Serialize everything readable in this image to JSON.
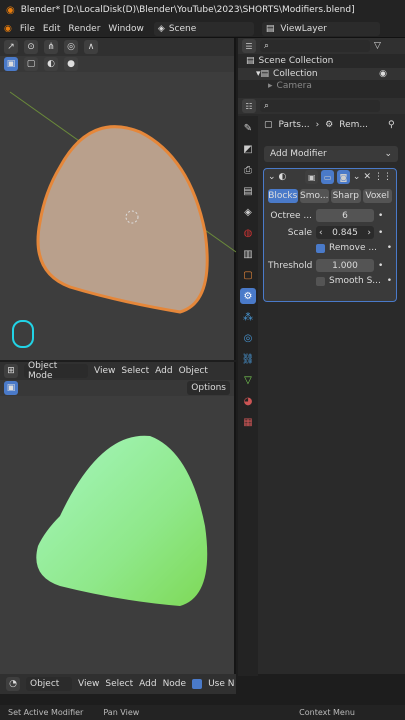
{
  "title": "Blender* [D:\\LocalDisk(D)\\Blender\\YouTube\\2023\\SHORTS\\Modifiers.blend]",
  "menu": [
    "File",
    "Edit",
    "Render",
    "Window"
  ],
  "scene": "Scene",
  "view_layer": "ViewLayer",
  "outliner": {
    "scene_collection": "Scene Collection",
    "collection": "Collection",
    "camera": "Camera"
  },
  "props": {
    "breadcrumb_obj": "Parts...",
    "breadcrumb_mod": "Rem...",
    "add_modifier": "Add Modifier",
    "modes": [
      "Blocks",
      "Smo...",
      "Sharp",
      "Voxel"
    ],
    "octree_label": "Octree ...",
    "octree_value": "6",
    "scale_label": "Scale",
    "scale_value": "0.845",
    "remove_label": "Remove ...",
    "threshold_label": "Threshold",
    "threshold_value": "1.000",
    "smooth_label": "Smooth S..."
  },
  "vp_bottom": {
    "mode": "Object Mode",
    "menus": [
      "View",
      "Select",
      "Add",
      "Object"
    ],
    "options": "Options"
  },
  "node_header": {
    "mode": "Object",
    "menus": [
      "View",
      "Select",
      "Add",
      "Node"
    ],
    "use_nodes": "Use N"
  },
  "status": {
    "a": "Set Active Modifier",
    "b": "Pan View",
    "c": "Context Menu"
  },
  "colors": {
    "accent": "#4a7ac9",
    "orange": "#e5873a",
    "green": "#7ed957"
  }
}
